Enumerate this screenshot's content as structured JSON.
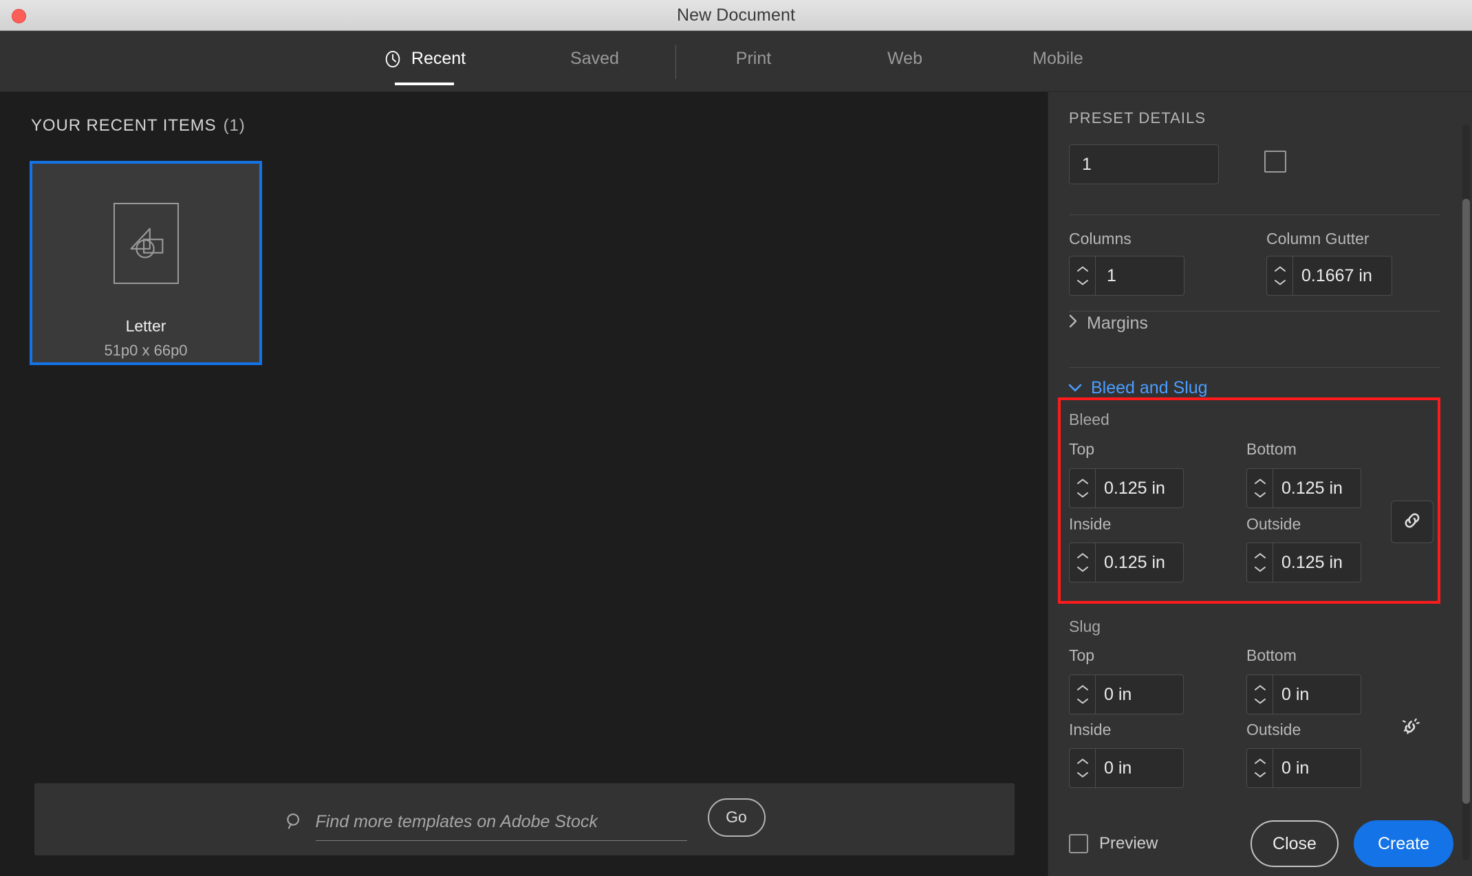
{
  "window": {
    "title": "New Document",
    "close_button": "close-window"
  },
  "tabs": [
    {
      "id": "recent",
      "label": "Recent",
      "icon": "clock-icon",
      "active": true
    },
    {
      "id": "saved",
      "label": "Saved",
      "icon": null,
      "active": false
    },
    {
      "id": "print",
      "label": "Print",
      "icon": null,
      "active": false
    },
    {
      "id": "web",
      "label": "Web",
      "icon": null,
      "active": false
    },
    {
      "id": "mobile",
      "label": "Mobile",
      "icon": null,
      "active": false
    }
  ],
  "main": {
    "section_header": "YOUR RECENT ITEMS",
    "section_count": "(1)",
    "items": [
      {
        "title": "Letter",
        "size": "51p0 x 66p0",
        "selected": true
      }
    ],
    "search": {
      "placeholder": "Find more templates on Adobe Stock",
      "value": "",
      "go_label": "Go"
    }
  },
  "panel": {
    "title": "PRESET DETAILS",
    "pages_value": "1",
    "facing_pages_checked": false,
    "columns": {
      "label": "Columns",
      "value": "1"
    },
    "column_gutter": {
      "label": "Column Gutter",
      "value": "0.1667 in"
    },
    "margins": {
      "label": "Margins",
      "expanded": false
    },
    "bleed_and_slug": {
      "label": "Bleed and Slug",
      "expanded": true,
      "bleed": {
        "label": "Bleed",
        "top": {
          "label": "Top",
          "value": "0.125 in"
        },
        "bottom": {
          "label": "Bottom",
          "value": "0.125 in"
        },
        "inside": {
          "label": "Inside",
          "value": "0.125 in"
        },
        "outside": {
          "label": "Outside",
          "value": "0.125 in"
        },
        "link_state": "linked"
      },
      "slug": {
        "label": "Slug",
        "top": {
          "label": "Top",
          "value": "0 in"
        },
        "bottom": {
          "label": "Bottom",
          "value": "0 in"
        },
        "inside": {
          "label": "Inside",
          "value": "0 in"
        },
        "outside": {
          "label": "Outside",
          "value": "0 in"
        },
        "link_state": "unlinked"
      }
    },
    "footer": {
      "preview_label": "Preview",
      "preview_checked": false,
      "close_label": "Close",
      "create_label": "Create"
    }
  },
  "colors": {
    "accent_blue": "#1473e6",
    "link_blue": "#4a9eff",
    "highlight_red": "#ff1b1b",
    "panel_bg": "#323232",
    "main_bg": "#1d1d1d",
    "field_bg": "#2b2b2b"
  }
}
